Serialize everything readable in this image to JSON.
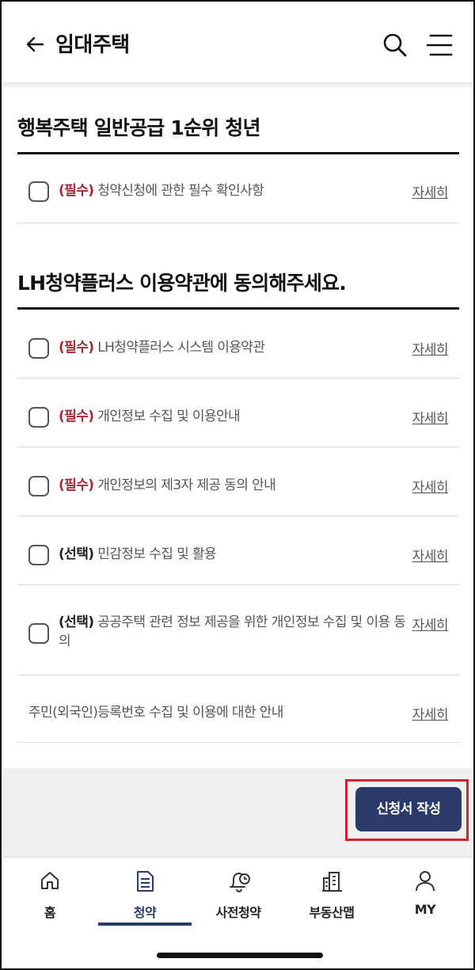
{
  "header": {
    "title": "임대주택",
    "back_icon": "arrow-left-icon",
    "search_icon": "search-icon",
    "menu_icon": "hamburger-menu-icon"
  },
  "section1": {
    "title": "행복주택 일반공급 1순위 청년",
    "items": [
      {
        "tag": "(필수)",
        "text": " 청약신청에 관한 필수 확인사항",
        "detail": "자세히",
        "checked": false
      }
    ]
  },
  "section2": {
    "title": "LH청약플러스 이용약관에 동의해주세요.",
    "items": [
      {
        "tag": "(필수)",
        "text": " LH청약플러스 시스템 이용약관",
        "detail": "자세히",
        "checked": false
      },
      {
        "tag": "(필수)",
        "text": " 개인정보 수집 및 이용안내",
        "detail": "자세히",
        "checked": false
      },
      {
        "tag": "(필수)",
        "text": " 개인정보의 제3자 제공 동의 안내",
        "detail": "자세히",
        "checked": false
      },
      {
        "tag": "(선택)",
        "text": " 민감정보 수집 및 활용",
        "detail": "자세히",
        "checked": false
      },
      {
        "tag": "(선택)",
        "text": " 공공주택 관련 정보 제공을 위한 개인정보 수집 및 이용 동의",
        "detail": "자세히",
        "checked": false
      }
    ],
    "notice": {
      "text": "주민(외국인)등록번호 수집 및 이용에 대한 안내",
      "detail": "자세히"
    }
  },
  "action": {
    "apply_label": "신청서 작성"
  },
  "bottom_nav": {
    "items": [
      {
        "label": "홈",
        "icon": "home-icon",
        "active": false
      },
      {
        "label": "청약",
        "icon": "document-icon",
        "active": true
      },
      {
        "label": "사전청약",
        "icon": "bell-clock-icon",
        "active": false
      },
      {
        "label": "부동산맵",
        "icon": "building-map-icon",
        "active": false
      },
      {
        "label": "MY",
        "icon": "user-icon",
        "active": false
      }
    ]
  },
  "colors": {
    "required": "#a02a35",
    "primary": "#2a3a6a",
    "highlight_border": "#d9202a"
  }
}
